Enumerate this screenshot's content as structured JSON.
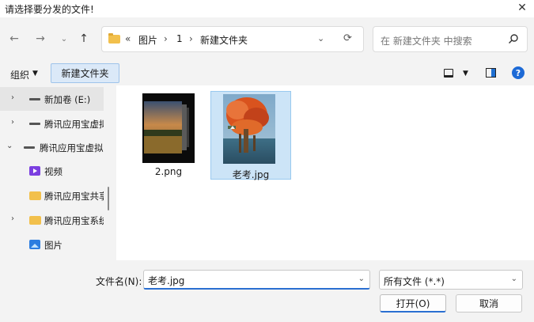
{
  "window": {
    "title": "请选择要分发的文件!"
  },
  "nav": {
    "breadcrumb": {
      "overflow": "«",
      "items": [
        "图片",
        "1",
        "新建文件夹"
      ]
    },
    "search_placeholder": "在 新建文件夹 中搜索"
  },
  "toolbar": {
    "organize_label": "组织",
    "new_folder_label": "新建文件夹"
  },
  "sidebar": {
    "items": [
      {
        "label": "新加卷 (E:)",
        "icon": "drive-icon",
        "expander": "collapsed",
        "selected": true
      },
      {
        "label": "腾讯应用宝虚拟",
        "icon": "drive-icon",
        "expander": "collapsed",
        "selected": false
      },
      {
        "label": "腾讯应用宝虚拟",
        "icon": "drive-icon",
        "expander": "expanded",
        "selected": false
      },
      {
        "label": "视频",
        "icon": "video-icon",
        "expander": "none",
        "selected": false
      },
      {
        "label": "腾讯应用宝共享",
        "icon": "folder-icon",
        "expander": "none",
        "selected": false
      },
      {
        "label": "腾讯应用宝系统",
        "icon": "folder-icon",
        "expander": "collapsed",
        "selected": false
      },
      {
        "label": "图片",
        "icon": "picture-icon",
        "expander": "none",
        "selected": false
      }
    ]
  },
  "files": [
    {
      "name": "2.png",
      "selected": false
    },
    {
      "name": "老考.jpg",
      "selected": true
    }
  ],
  "footer": {
    "filename_label": "文件名(N):",
    "filename_value": "老考.jpg",
    "filetype_value": "所有文件 (*.*)",
    "open_label": "打开(O)",
    "cancel_label": "取消"
  },
  "colors": {
    "accent": "#2a6fd1",
    "selection": "#cce4f7",
    "folder": "#f2c04c"
  }
}
